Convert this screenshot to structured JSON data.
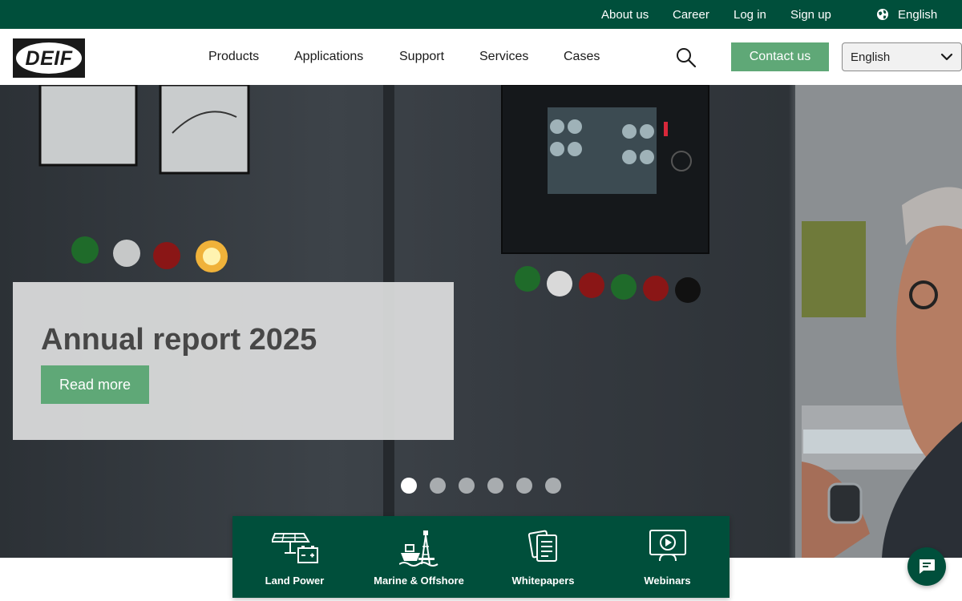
{
  "topbar": {
    "links": [
      "About us",
      "Career",
      "Log in",
      "Sign up"
    ],
    "language": "English"
  },
  "header": {
    "logo_text": "DEIF",
    "nav": [
      "Products",
      "Applications",
      "Support",
      "Services",
      "Cases"
    ],
    "contact_label": "Contact us",
    "language_select": {
      "selected": "English"
    }
  },
  "hero": {
    "title": "Annual report 2025",
    "button_label": "Read more",
    "slides_total": 6,
    "active_slide": 1
  },
  "quick_links": [
    {
      "label": "Land Power",
      "icon": "solar-battery-icon"
    },
    {
      "label": "Marine & Offshore",
      "icon": "ship-rig-icon"
    },
    {
      "label": "Whitepapers",
      "icon": "documents-icon"
    },
    {
      "label": "Webinars",
      "icon": "webinar-icon"
    }
  ],
  "colors": {
    "brand_dark_green": "#004f3b",
    "accent_green": "#5fa877",
    "card_bg": "#dddede"
  }
}
